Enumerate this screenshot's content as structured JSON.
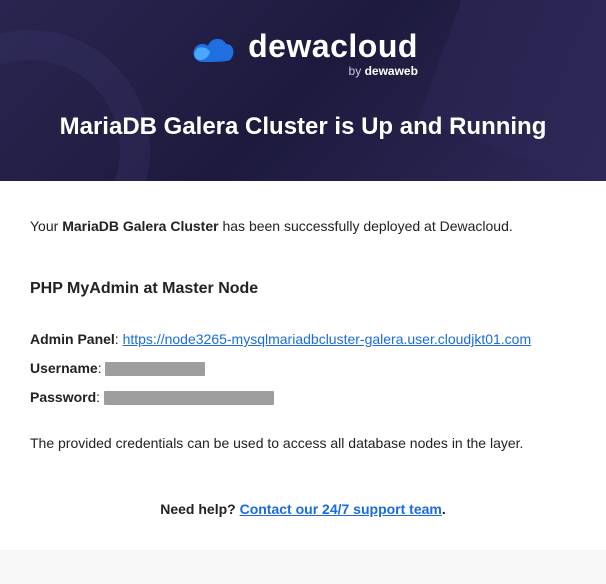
{
  "brand": {
    "name": "dewacloud",
    "by_prefix": "by ",
    "by_name": "dewaweb"
  },
  "header": {
    "title": "MariaDB Galera Cluster is Up and Running"
  },
  "intro": {
    "prefix": "Your ",
    "product": "MariaDB Galera Cluster",
    "suffix": " has been successfully deployed at Dewacloud."
  },
  "section": {
    "title": "PHP MyAdmin at Master Node"
  },
  "fields": {
    "admin_label": "Admin Panel",
    "admin_url": "https://node3265-mysqlmariadbcluster-galera.user.cloudjkt01.com",
    "username_label": "Username",
    "password_label": "Password"
  },
  "note": "The provided credentials can be used to access all database nodes in the layer.",
  "support": {
    "prefix": "Need help? ",
    "link_text": "Contact our 24/7 support team",
    "suffix": "."
  }
}
